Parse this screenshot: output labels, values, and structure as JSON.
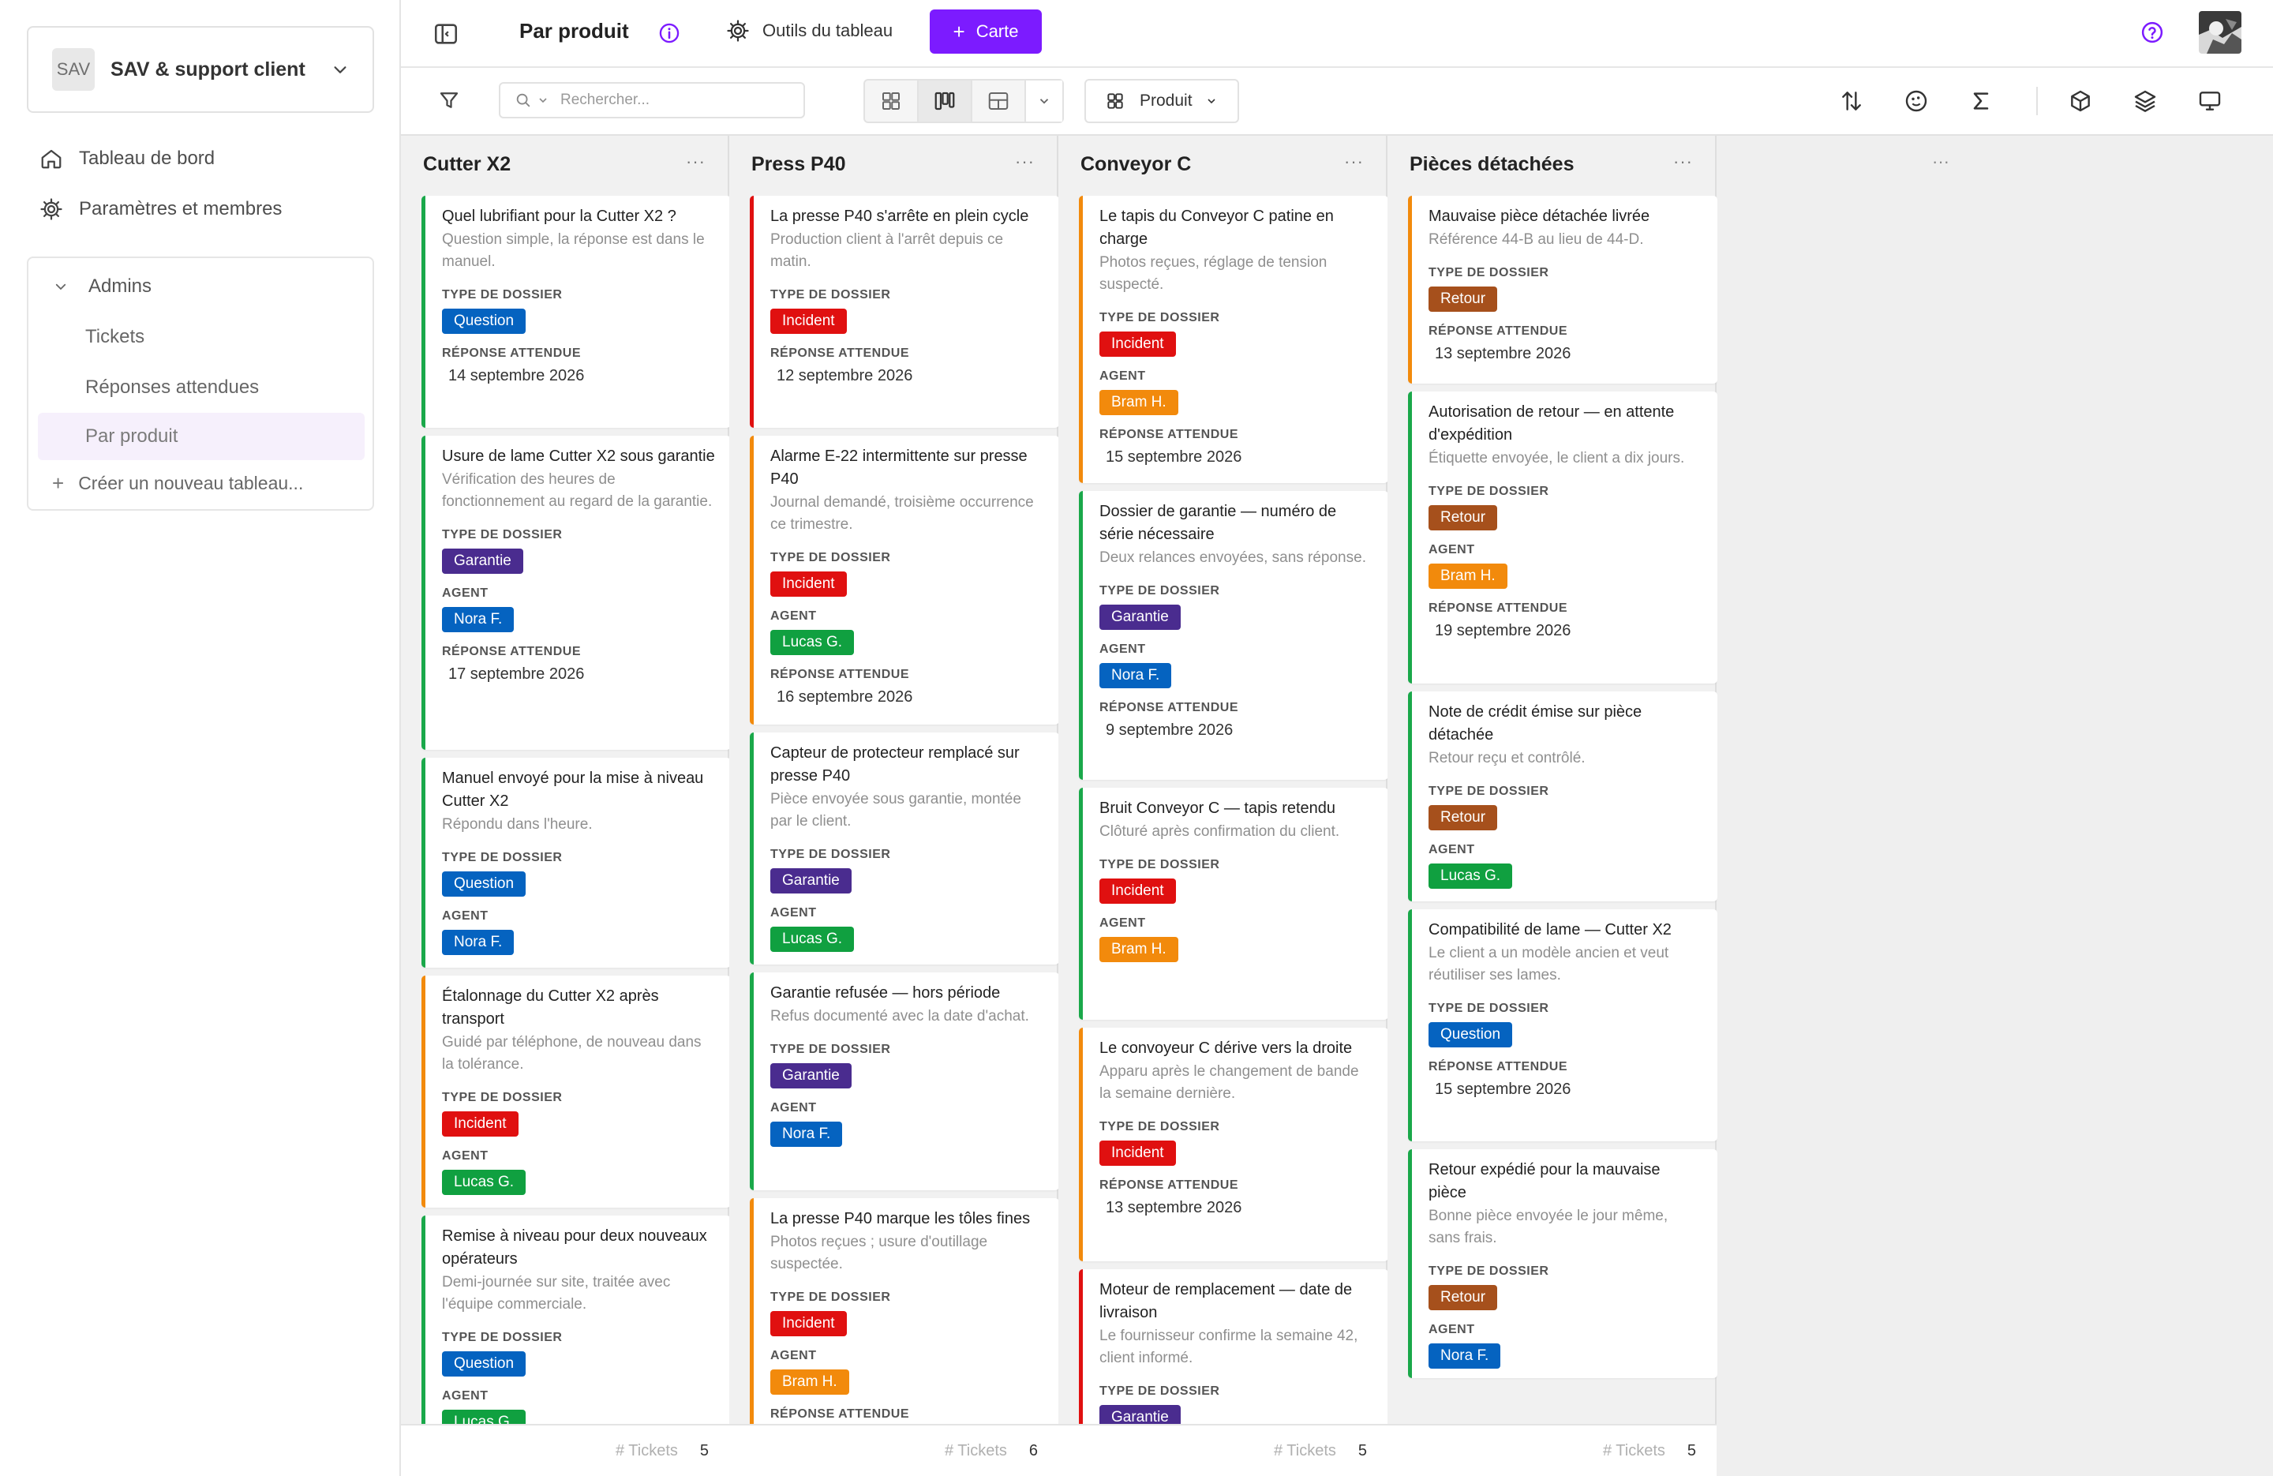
{
  "workspace": {
    "avatar": "SAV",
    "name": "SAV & support client"
  },
  "nav": {
    "dashboard": "Tableau de bord",
    "settings": "Paramètres et membres"
  },
  "views": {
    "group": "Admins",
    "items": [
      "Tickets",
      "Réponses attendues",
      "Par produit"
    ],
    "create": "Créer un nouveau tableau..."
  },
  "topbar": {
    "title": "Par produit",
    "tools": "Outils du tableau",
    "card_button": "Carte"
  },
  "toolbar": {
    "search_placeholder": "Rechercher...",
    "group_by": "Produit"
  },
  "labels": {
    "type": "TYPE DE DOSSIER",
    "agent": "AGENT",
    "due": "RÉPONSE ATTENDUE",
    "footer": "# Tickets",
    "more": "···"
  },
  "colors": {
    "accent": "#7c1bff",
    "Question": "#0563c0",
    "Incident": "#e01010",
    "Garantie": "#4a2c8f",
    "Retour": "#a6501c",
    "Nora F.": "#0563c0",
    "Lucas G.": "#10a040",
    "Bram H.": "#f28a0c"
  },
  "columns": [
    {
      "name": "Cutter X2",
      "count": "5",
      "cards": [
        {
          "title": "Quel lubrifiant pour la Cutter X2 ?",
          "desc": "Question simple, la réponse est dans le manuel.",
          "type": "Question",
          "agent": "",
          "due": "14 septembre 2026",
          "accent": "#1aa84a"
        },
        {
          "title": "Usure de lame Cutter X2 sous garantie",
          "desc": "Vérification des heures de fonctionnement au regard de la garantie.",
          "type": "Garantie",
          "agent": "Nora F.",
          "due": "17 septembre 2026",
          "accent": "#1aa84a"
        },
        {
          "title": "Manuel envoyé pour la mise à niveau Cutter X2",
          "desc": "Répondu dans l'heure.",
          "type": "Question",
          "agent": "Nora F.",
          "due": "",
          "accent": "#1aa84a"
        },
        {
          "title": "Étalonnage du Cutter X2 après transport",
          "desc": "Guidé par téléphone, de nouveau dans la tolérance.",
          "type": "Incident",
          "agent": "Lucas G.",
          "due": "",
          "accent": "#f28a0c"
        },
        {
          "title": "Remise à niveau pour deux nouveaux opérateurs",
          "desc": "Demi-journée sur site, traitée avec l'équipe commerciale.",
          "type": "Question",
          "agent": "Lucas G.",
          "due": "",
          "accent": "#1aa84a"
        }
      ]
    },
    {
      "name": "Press P40",
      "count": "6",
      "cards": [
        {
          "title": "La presse P40 s'arrête en plein cycle",
          "desc": "Production client à l'arrêt depuis ce matin.",
          "type": "Incident",
          "agent": "",
          "due": "12 septembre 2026",
          "accent": "#e01010"
        },
        {
          "title": "Alarme E-22 intermittente sur presse P40",
          "desc": "Journal demandé, troisième occurrence ce trimestre.",
          "type": "Incident",
          "agent": "Lucas G.",
          "due": "16 septembre 2026",
          "accent": "#f28a0c"
        },
        {
          "title": "Capteur de protecteur remplacé sur presse P40",
          "desc": "Pièce envoyée sous garantie, montée par le client.",
          "type": "Garantie",
          "agent": "Lucas G.",
          "due": "",
          "accent": "#1aa84a"
        },
        {
          "title": "Garantie refusée — hors période",
          "desc": "Refus documenté avec la date d'achat.",
          "type": "Garantie",
          "agent": "Nora F.",
          "due": "",
          "accent": "#1aa84a"
        },
        {
          "title": "La presse P40 marque les tôles fines",
          "desc": "Photos reçues ; usure d'outillage suspectée.",
          "type": "Incident",
          "agent": "Bram H.",
          "due": "...",
          "accent": "#f28a0c"
        }
      ]
    },
    {
      "name": "Conveyor C",
      "count": "5",
      "cards": [
        {
          "title": "Le tapis du Conveyor C patine en charge",
          "desc": "Photos reçues, réglage de tension suspecté.",
          "type": "Incident",
          "agent": "Bram H.",
          "due": "15 septembre 2026",
          "accent": "#f28a0c"
        },
        {
          "title": "Dossier de garantie — numéro de série nécessaire",
          "desc": "Deux relances envoyées, sans réponse.",
          "type": "Garantie",
          "agent": "Nora F.",
          "due": "9 septembre 2026",
          "accent": "#1aa84a"
        },
        {
          "title": "Bruit Conveyor C — tapis retendu",
          "desc": "Clôturé après confirmation du client.",
          "type": "Incident",
          "agent": "Bram H.",
          "due": "",
          "accent": "#1aa84a"
        },
        {
          "title": "Le convoyeur C dérive vers la droite",
          "desc": "Apparu après le changement de bande la semaine dernière.",
          "type": "Incident",
          "agent": "",
          "due": "13 septembre 2026",
          "accent": "#f28a0c"
        },
        {
          "title": "Moteur de remplacement — date de livraison",
          "desc": "Le fournisseur confirme la semaine 42, client informé.",
          "type": "Garantie",
          "agent": "",
          "due": "",
          "accent": "#e01010"
        }
      ]
    },
    {
      "name": "Pièces détachées",
      "count": "5",
      "cards": [
        {
          "title": "Mauvaise pièce détachée livrée",
          "desc": "Référence 44-B au lieu de 44-D.",
          "type": "Retour",
          "agent": "",
          "due": "13 septembre 2026",
          "accent": "#f28a0c"
        },
        {
          "title": "Autorisation de retour — en attente d'expédition",
          "desc": "Étiquette envoyée, le client a dix jours.",
          "type": "Retour",
          "agent": "Bram H.",
          "due": "19 septembre 2026",
          "accent": "#1aa84a"
        },
        {
          "title": "Note de crédit émise sur pièce détachée",
          "desc": "Retour reçu et contrôlé.",
          "type": "Retour",
          "agent": "Lucas G.",
          "due": "",
          "accent": "#1aa84a"
        },
        {
          "title": "Compatibilité de lame — Cutter X2",
          "desc": "Le client a un modèle ancien et veut réutiliser ses lames.",
          "type": "Question",
          "agent": "",
          "due": "15 septembre 2026",
          "accent": "#1aa84a"
        },
        {
          "title": "Retour expédié pour la mauvaise pièce",
          "desc": "Bonne pièce envoyée le jour même, sans frais.",
          "type": "Retour",
          "agent": "Nora F.",
          "due": "",
          "accent": "#1aa84a"
        }
      ]
    }
  ]
}
